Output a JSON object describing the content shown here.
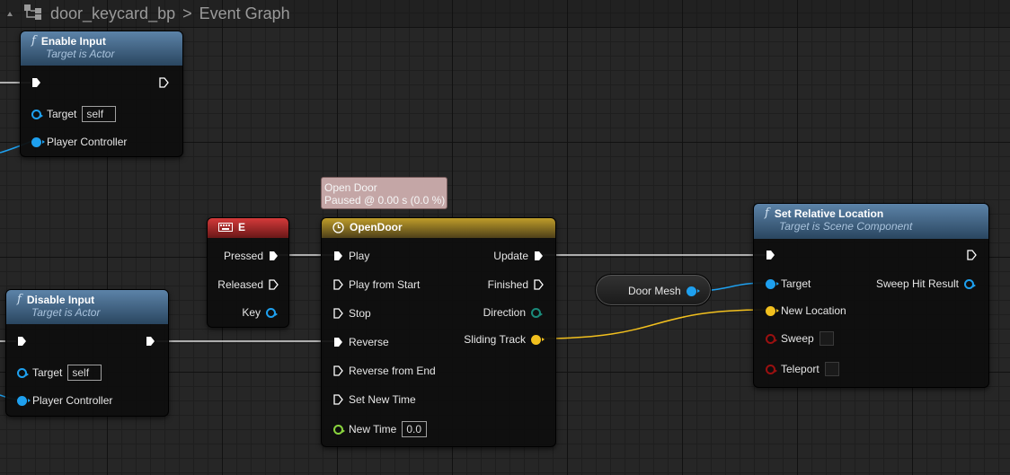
{
  "breadcrumb": {
    "blueprint": "door_keycard_bp",
    "separator": ">",
    "graph": "Event Graph"
  },
  "tooltip": {
    "line1": "Open Door",
    "line2": "Paused @ 0.00 s (0.0 %)"
  },
  "nodes": {
    "enable_input": {
      "title": "Enable Input",
      "subtitle": "Target is Actor",
      "target_label": "Target",
      "target_value": "self",
      "player_controller": "Player Controller"
    },
    "disable_input": {
      "title": "Disable Input",
      "subtitle": "Target is Actor",
      "target_label": "Target",
      "target_value": "self",
      "player_controller": "Player Controller"
    },
    "key_event": {
      "title": "E",
      "pressed": "Pressed",
      "released": "Released",
      "key": "Key"
    },
    "timeline": {
      "title": "OpenDoor",
      "inputs": [
        "Play",
        "Play from Start",
        "Stop",
        "Reverse",
        "Reverse from End",
        "Set New Time"
      ],
      "new_time_label": "New Time",
      "new_time_value": "0.0",
      "outputs": {
        "update": "Update",
        "finished": "Finished",
        "direction": "Direction",
        "sliding_track": "Sliding Track"
      }
    },
    "door_mesh": {
      "label": "Door Mesh"
    },
    "set_relative_location": {
      "title": "Set Relative Location",
      "subtitle": "Target is Scene Component",
      "target": "Target",
      "new_location": "New Location",
      "sweep": "Sweep",
      "teleport": "Teleport",
      "sweep_hit_result": "Sweep Hit Result"
    }
  },
  "colors": {
    "exec": "#ffffff",
    "object": "#1ea0ef",
    "vector": "#f2c01e",
    "bool": "#9a1010",
    "float": "#8ad43e",
    "enum": "#1a8a7a"
  }
}
